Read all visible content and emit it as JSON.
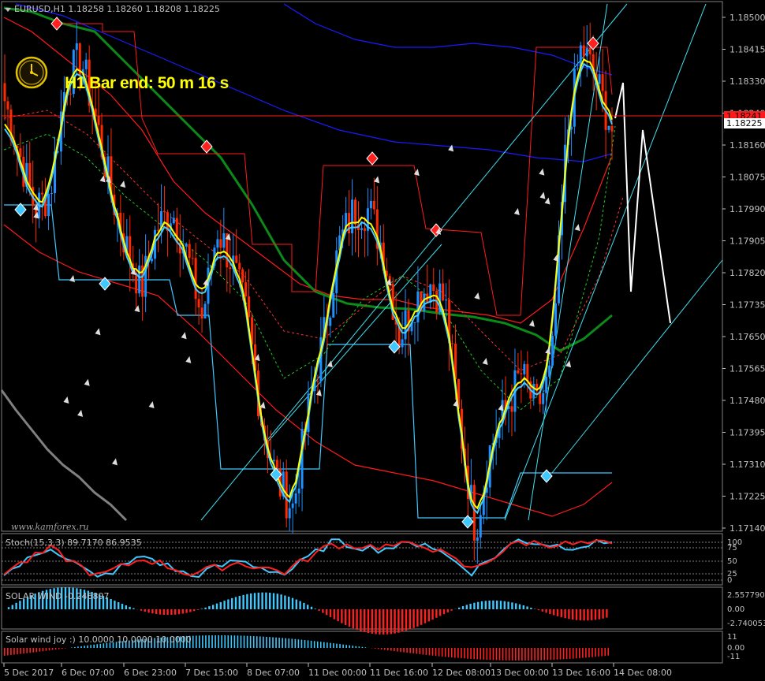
{
  "header": {
    "symbol_line": "EURUSD,H1  1.18258 1.18260 1.18208 1.18225",
    "timer_text": "H1 Bar end: 50 m 16 s",
    "watermark": "www.kamforex.ru"
  },
  "price_axis": {
    "ticks": [
      "1.18500",
      "1.18415",
      "1.18330",
      "1.18240",
      "1.18160",
      "1.18075",
      "1.17990",
      "1.17905",
      "1.17820",
      "1.17735",
      "1.17650",
      "1.17565",
      "1.17480",
      "1.17395",
      "1.17310",
      "1.17225",
      "1.17140"
    ],
    "current_price": "1.18225",
    "red_level_price": "1.18241"
  },
  "time_axis": {
    "labels": [
      "5 Dec 2017",
      "6 Dec 07:00",
      "6 Dec 23:00",
      "7 Dec 15:00",
      "8 Dec 07:00",
      "11 Dec 00:00",
      "11 Dec 16:00",
      "12 Dec 08:00",
      "13 Dec 00:00",
      "13 Dec 16:00",
      "14 Dec 08:00"
    ]
  },
  "panels": {
    "stoch": {
      "label": "Stoch(15,3,3) 89.7170 86.9535",
      "ticks": [
        "100",
        "75",
        "50",
        "25",
        "0"
      ]
    },
    "solar_wind": {
      "label": "SOLAR WIND -0.246897",
      "ticks": [
        "2.557790",
        "0.00",
        "-2.740053"
      ]
    },
    "solar_joy": {
      "label": "Solar wind joy :) 10.0000 10.0000 10.0000",
      "ticks": [
        "11",
        "0.00",
        "-11"
      ]
    }
  },
  "colors": {
    "background": "#000000",
    "bull": "#1e90ff",
    "bear": "#ff2a00",
    "fast_ma": "#ffff00",
    "trend_line": "#44ccff",
    "channel_red": "#ff1a1a",
    "channel_blue": "#1a1aff",
    "ma_green": "#0b8a1a",
    "cyan_lines": "#40e0f0",
    "white": "#ffffff"
  },
  "chart_data": [
    {
      "type": "candlestick",
      "title": "EURUSD,H1",
      "ylim": [
        1.1714,
        1.1856
      ],
      "x": [
        "5 Dec 2017",
        "6 Dec 07:00",
        "6 Dec 23:00",
        "7 Dec 15:00",
        "8 Dec 07:00",
        "11 Dec 00:00",
        "11 Dec 16:00",
        "12 Dec 08:00",
        "13 Dec 00:00",
        "13 Dec 16:00",
        "14 Dec 08:00"
      ],
      "close_path": [
        1.183,
        1.1815,
        1.18,
        1.1805,
        1.1835,
        1.1842,
        1.1825,
        1.1805,
        1.179,
        1.1778,
        1.1795,
        1.18,
        1.1788,
        1.177,
        1.1795,
        1.1785,
        1.177,
        1.174,
        1.1725,
        1.1718,
        1.1745,
        1.1765,
        1.179,
        1.18,
        1.18,
        1.1788,
        1.1765,
        1.1775,
        1.178,
        1.1775,
        1.174,
        1.1712,
        1.1735,
        1.1745,
        1.1755,
        1.1745,
        1.1755,
        1.182,
        1.1845,
        1.1835,
        1.1822
      ]
    },
    {
      "type": "line",
      "title": "Stoch(15,3,3)",
      "ylim": [
        0,
        100
      ],
      "series": [
        {
          "name": "main",
          "values": [
            20,
            80,
            10,
            60,
            15,
            50,
            20,
            90,
            75,
            90,
            25,
            95,
            80,
            90
          ]
        },
        {
          "name": "signal",
          "values": [
            25,
            75,
            15,
            55,
            20,
            45,
            25,
            85,
            80,
            85,
            30,
            90,
            85,
            86.9535
          ]
        }
      ]
    },
    {
      "type": "bar",
      "title": "SOLAR WIND",
      "ylim": [
        -2.740053,
        2.55779
      ]
    },
    {
      "type": "bar",
      "title": "Solar wind joy :)",
      "ylim": [
        -11,
        11
      ]
    }
  ]
}
